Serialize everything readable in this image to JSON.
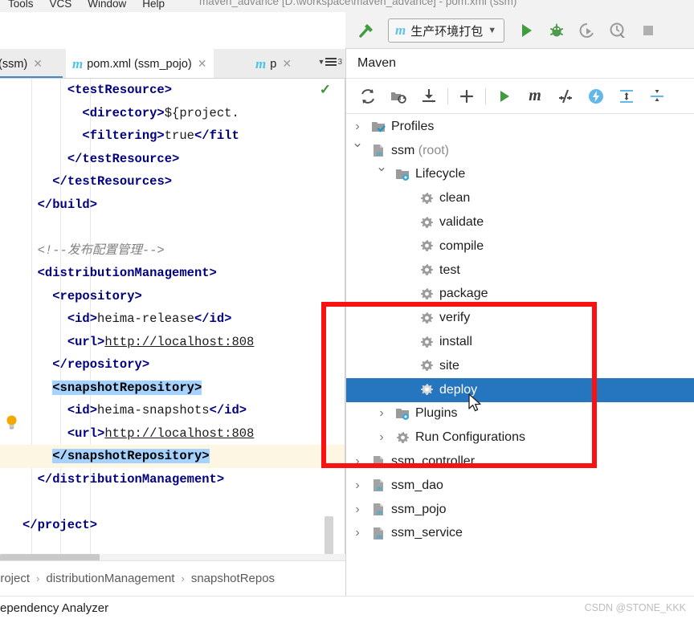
{
  "window": {
    "title": "maven_advance [D:\\workspace\\maven_advance] - pom.xml (ssm)",
    "menu_items": [
      "Tools",
      "VCS",
      "Window",
      "Help"
    ]
  },
  "toolbar": {
    "run_config_name": "生产环境打包",
    "run_config_icon": "maven-m-icon",
    "buttons": [
      {
        "name": "build-hammer-icon",
        "label": "Build"
      },
      {
        "name": "run-icon",
        "label": "Run"
      },
      {
        "name": "debug-icon",
        "label": "Debug"
      },
      {
        "name": "run-with-coverage-icon",
        "label": "Run with Coverage"
      },
      {
        "name": "profile-icon",
        "label": "Profiler"
      },
      {
        "name": "stop-icon",
        "label": "Stop"
      }
    ]
  },
  "editor_tabs": {
    "tabs": [
      {
        "name": "tab-pom-ssm",
        "label": "(ssm)",
        "icon": "",
        "active": false
      },
      {
        "name": "tab-pom-ssm-pojo",
        "label": "pom.xml (ssm_pojo)",
        "icon": "maven-m-icon",
        "active": true
      },
      {
        "name": "tab-pom-partial",
        "label": "p",
        "icon": "maven-m-icon",
        "active": false
      }
    ],
    "more_tabs_label": "3"
  },
  "code": {
    "lines": [
      {
        "indent": 6,
        "segments": [
          {
            "t": "tag",
            "v": "<testResource>"
          }
        ]
      },
      {
        "indent": 8,
        "segments": [
          {
            "t": "tag",
            "v": "<directory>"
          },
          {
            "t": "txt",
            "v": "${project."
          }
        ]
      },
      {
        "indent": 8,
        "segments": [
          {
            "t": "tag",
            "v": "<filtering>"
          },
          {
            "t": "txt",
            "v": "true"
          },
          {
            "t": "tag",
            "v": "</filt"
          }
        ]
      },
      {
        "indent": 6,
        "segments": [
          {
            "t": "tag",
            "v": "</testResource>"
          }
        ]
      },
      {
        "indent": 4,
        "segments": [
          {
            "t": "tag",
            "v": "</testResources>"
          }
        ]
      },
      {
        "indent": 2,
        "segments": [
          {
            "t": "tag",
            "v": "</build>"
          }
        ]
      },
      {
        "indent": 0,
        "segments": []
      },
      {
        "indent": 2,
        "segments": [
          {
            "t": "cmt",
            "v": "<!--发布配置管理-->"
          }
        ]
      },
      {
        "indent": 2,
        "segments": [
          {
            "t": "tag",
            "v": "<distributionManagement>"
          }
        ]
      },
      {
        "indent": 4,
        "segments": [
          {
            "t": "tag",
            "v": "<repository>"
          }
        ]
      },
      {
        "indent": 6,
        "segments": [
          {
            "t": "tag",
            "v": "<id>"
          },
          {
            "t": "txt",
            "v": "heima-release"
          },
          {
            "t": "tag",
            "v": "</id>"
          }
        ]
      },
      {
        "indent": 6,
        "segments": [
          {
            "t": "tag",
            "v": "<url>"
          },
          {
            "t": "url",
            "v": "http://localhost:808"
          }
        ]
      },
      {
        "indent": 4,
        "segments": [
          {
            "t": "tag",
            "v": "</repository>"
          }
        ]
      },
      {
        "indent": 4,
        "segments": [
          {
            "t": "sel",
            "v": "<snapshotRepository>"
          }
        ]
      },
      {
        "indent": 6,
        "segments": [
          {
            "t": "tag",
            "v": "<id>"
          },
          {
            "t": "txt",
            "v": "heima-snapshots"
          },
          {
            "t": "tag",
            "v": "</id>"
          }
        ]
      },
      {
        "indent": 6,
        "segments": [
          {
            "t": "tag",
            "v": "<url>"
          },
          {
            "t": "url",
            "v": "http://localhost:808"
          }
        ]
      },
      {
        "indent": 4,
        "highlight": true,
        "segments": [
          {
            "t": "sel",
            "v": "</snapshotRepository>"
          }
        ]
      },
      {
        "indent": 2,
        "segments": [
          {
            "t": "tag",
            "v": "</distributionManagement>"
          }
        ]
      },
      {
        "indent": 0,
        "segments": []
      },
      {
        "indent": 0,
        "segments": [
          {
            "t": "tag",
            "v": "</project>"
          }
        ]
      }
    ]
  },
  "breadcrumb": {
    "items": [
      "project",
      "distributionManagement",
      "snapshotRepos"
    ],
    "separator": "›"
  },
  "bottom": {
    "dependency_analyzer_label": "ependency Analyzer",
    "watermark": "CSDN @STONE_KKK"
  },
  "maven": {
    "title": "Maven",
    "toolbar_buttons": [
      {
        "name": "reload-all-maven-projects-icon",
        "label": "Reload All Maven Projects"
      },
      {
        "name": "generate-sources-icon",
        "label": "Generate Sources and Update Folders"
      },
      {
        "name": "download-sources-icon",
        "label": "Download Sources"
      },
      {
        "name": "add-maven-project-icon",
        "label": "Add Maven Project"
      },
      {
        "name": "execute-goal-run-icon",
        "label": "Run"
      },
      {
        "name": "execute-maven-goal-icon",
        "label": "Execute Maven Goal"
      },
      {
        "name": "toggle-skip-tests-icon",
        "label": "Toggle Skip Tests Mode"
      },
      {
        "name": "toggle-offline-mode-icon",
        "label": "Toggle Offline Mode"
      },
      {
        "name": "expand-all-icon",
        "label": "Expand All"
      },
      {
        "name": "collapse-all-icon",
        "label": "Collapse All"
      }
    ],
    "tree": [
      {
        "name": "tree-item-profiles",
        "label": "Profiles",
        "suffix": "",
        "depth": 0,
        "arrow": "collapsed",
        "icon": "profiles-folder-icon",
        "selected": false
      },
      {
        "name": "tree-item-ssm-root",
        "label": "ssm",
        "suffix": " (root)",
        "depth": 0,
        "arrow": "expanded",
        "icon": "maven-project-icon",
        "selected": false
      },
      {
        "name": "tree-item-lifecycle",
        "label": "Lifecycle",
        "suffix": "",
        "depth": 1,
        "arrow": "expanded",
        "icon": "lifecycle-folder-icon",
        "selected": false
      },
      {
        "name": "tree-item-goal-clean",
        "label": "clean",
        "suffix": "",
        "depth": 2,
        "arrow": "none",
        "icon": "maven-goal-gear-icon",
        "selected": false
      },
      {
        "name": "tree-item-goal-validate",
        "label": "validate",
        "suffix": "",
        "depth": 2,
        "arrow": "none",
        "icon": "maven-goal-gear-icon",
        "selected": false
      },
      {
        "name": "tree-item-goal-compile",
        "label": "compile",
        "suffix": "",
        "depth": 2,
        "arrow": "none",
        "icon": "maven-goal-gear-icon",
        "selected": false
      },
      {
        "name": "tree-item-goal-test",
        "label": "test",
        "suffix": "",
        "depth": 2,
        "arrow": "none",
        "icon": "maven-goal-gear-icon",
        "selected": false
      },
      {
        "name": "tree-item-goal-package",
        "label": "package",
        "suffix": "",
        "depth": 2,
        "arrow": "none",
        "icon": "maven-goal-gear-icon",
        "selected": false
      },
      {
        "name": "tree-item-goal-verify",
        "label": "verify",
        "suffix": "",
        "depth": 2,
        "arrow": "none",
        "icon": "maven-goal-gear-icon",
        "selected": false
      },
      {
        "name": "tree-item-goal-install",
        "label": "install",
        "suffix": "",
        "depth": 2,
        "arrow": "none",
        "icon": "maven-goal-gear-icon",
        "selected": false
      },
      {
        "name": "tree-item-goal-site",
        "label": "site",
        "suffix": "",
        "depth": 2,
        "arrow": "none",
        "icon": "maven-goal-gear-icon",
        "selected": false
      },
      {
        "name": "tree-item-goal-deploy",
        "label": "deploy",
        "suffix": "",
        "depth": 2,
        "arrow": "none",
        "icon": "maven-goal-gear-icon",
        "selected": true
      },
      {
        "name": "tree-item-plugins",
        "label": "Plugins",
        "suffix": "",
        "depth": 1,
        "arrow": "collapsed",
        "icon": "plugins-folder-icon",
        "selected": false
      },
      {
        "name": "tree-item-run-configurations",
        "label": "Run Configurations",
        "suffix": "",
        "depth": 1,
        "arrow": "collapsed",
        "icon": "run-config-gear-icon",
        "selected": false
      },
      {
        "name": "tree-item-ssm-controller",
        "label": "ssm_controller",
        "suffix": "",
        "depth": 0,
        "arrow": "collapsed",
        "icon": "maven-project-icon",
        "selected": false
      },
      {
        "name": "tree-item-ssm-dao",
        "label": "ssm_dao",
        "suffix": "",
        "depth": 0,
        "arrow": "collapsed",
        "icon": "maven-project-icon",
        "selected": false
      },
      {
        "name": "tree-item-ssm-pojo",
        "label": "ssm_pojo",
        "suffix": "",
        "depth": 0,
        "arrow": "collapsed",
        "icon": "maven-project-icon",
        "selected": false
      },
      {
        "name": "tree-item-ssm-service",
        "label": "ssm_service",
        "suffix": "",
        "depth": 0,
        "arrow": "collapsed",
        "icon": "maven-project-icon",
        "selected": false
      }
    ]
  },
  "annotation": {
    "highlight_box_color": "#fa1212"
  }
}
